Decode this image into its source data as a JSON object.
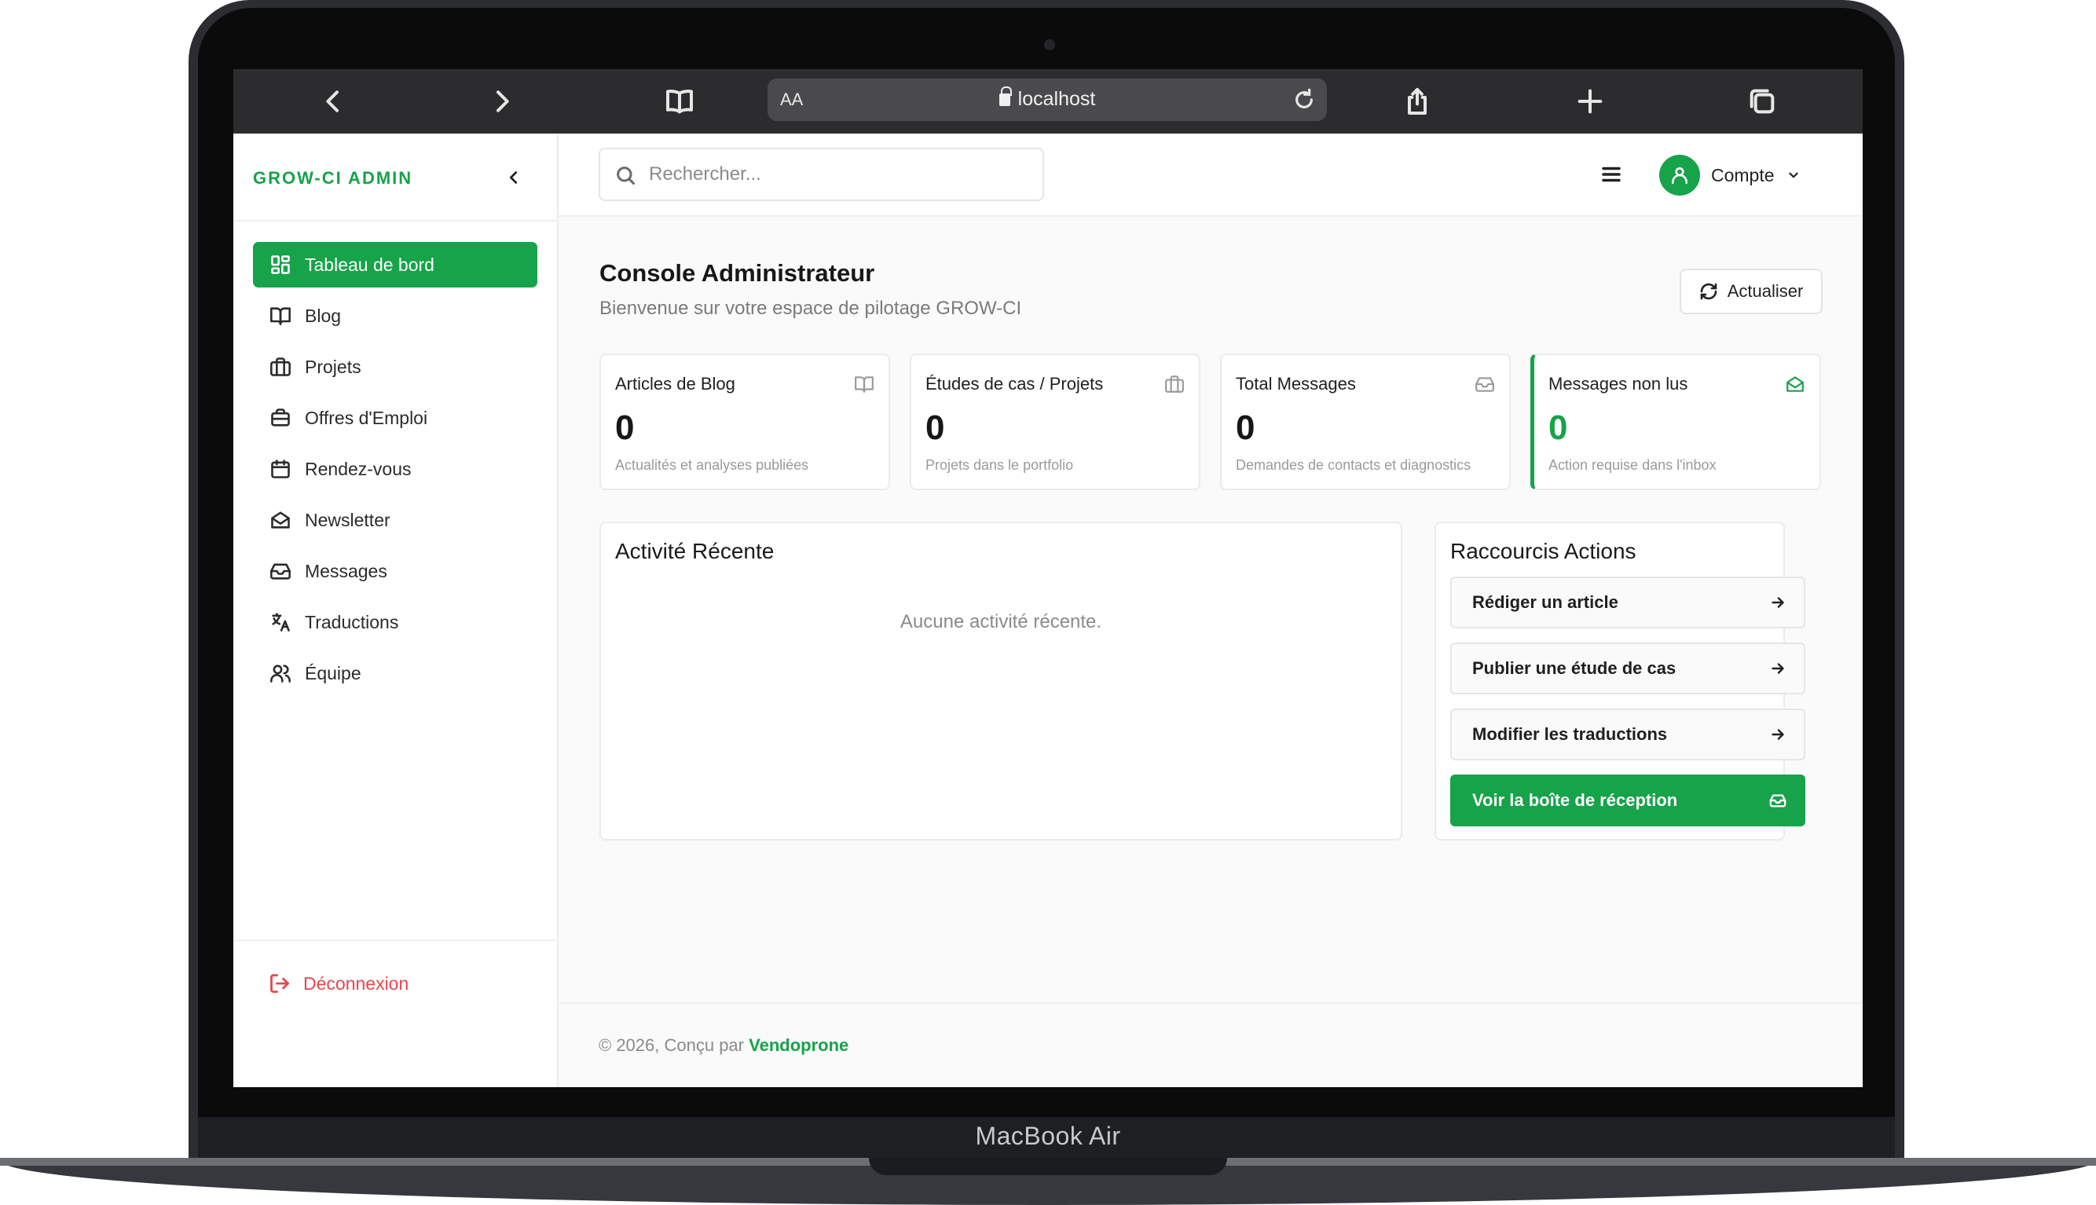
{
  "device": {
    "label": "MacBook Air"
  },
  "browser": {
    "address_text_size": "AA",
    "url": "localhost",
    "icons": [
      "back-icon",
      "forward-icon",
      "bookmarks-icon",
      "reload-icon",
      "share-icon",
      "new-tab-icon",
      "tabs-icon"
    ]
  },
  "sidebar": {
    "brand": "GROW-CI ADMIN",
    "items": [
      {
        "label": "Tableau de bord",
        "icon": "dashboard-icon",
        "active": true
      },
      {
        "label": "Blog",
        "icon": "book-icon"
      },
      {
        "label": "Projets",
        "icon": "briefcase-icon"
      },
      {
        "label": "Offres d'Emploi",
        "icon": "job-icon"
      },
      {
        "label": "Rendez-vous",
        "icon": "calendar-icon"
      },
      {
        "label": "Newsletter",
        "icon": "mail-open-icon"
      },
      {
        "label": "Messages",
        "icon": "inbox-icon"
      },
      {
        "label": "Traductions",
        "icon": "translate-icon"
      },
      {
        "label": "Équipe",
        "icon": "users-icon"
      }
    ],
    "logout_label": "Déconnexion"
  },
  "header": {
    "search_placeholder": "Rechercher...",
    "account_label": "Compte"
  },
  "main": {
    "title": "Console Administrateur",
    "subtitle": "Bienvenue sur votre espace de pilotage GROW-CI",
    "refresh_label": "Actualiser",
    "stats": [
      {
        "title": "Articles de Blog",
        "value": "0",
        "desc": "Actualités et analyses publiées",
        "icon": "book-icon"
      },
      {
        "title": "Études de cas / Projets",
        "value": "0",
        "desc": "Projets dans le portfolio",
        "icon": "briefcase-icon"
      },
      {
        "title": "Total Messages",
        "value": "0",
        "desc": "Demandes de contacts et diagnostics",
        "icon": "inbox-icon"
      },
      {
        "title": "Messages non lus",
        "value": "0",
        "desc": "Action requise dans l'inbox",
        "icon": "mail-open-icon",
        "accent": "#16a34a"
      }
    ],
    "activity": {
      "title": "Activité Récente",
      "empty": "Aucune activité récente."
    },
    "shortcuts": {
      "title": "Raccourcis Actions",
      "items": [
        {
          "label": "Rédiger un article",
          "icon": "arrow-right-icon"
        },
        {
          "label": "Publier une étude de cas",
          "icon": "arrow-right-icon"
        },
        {
          "label": "Modifier les traductions",
          "icon": "arrow-right-icon"
        },
        {
          "label": "Voir la boîte de réception",
          "icon": "inbox-icon",
          "primary": true
        }
      ]
    }
  },
  "footer": {
    "text": "© 2026, Conçu par",
    "link": "Vendoprone"
  },
  "colors": {
    "accent": "#16a34a",
    "danger": "#e5484d",
    "toolbar": "#2c2c2e"
  }
}
